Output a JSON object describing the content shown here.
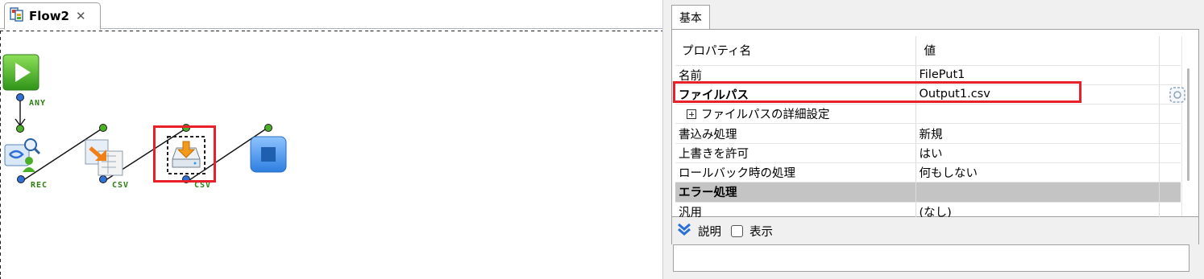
{
  "editor": {
    "tab_label": "Flow2",
    "tab_close": "✕",
    "ports": {
      "any": "ANY",
      "rec": "REC",
      "csv1": "CSV",
      "csv2": "CSV"
    }
  },
  "properties": {
    "tab_label": "基本",
    "columns": {
      "name": "プロパティ名",
      "value": "値"
    },
    "rows": [
      {
        "name": "名前",
        "value": "FilePut1"
      },
      {
        "name": "ファイルパス",
        "value": "Output1.csv"
      },
      {
        "name": "ファイルパスの詳細設定",
        "value": ""
      },
      {
        "name": "書込み処理",
        "value": "新規"
      },
      {
        "name": "上書きを許可",
        "value": "はい"
      },
      {
        "name": "ロールバック時の処理",
        "value": "何もしない"
      },
      {
        "name": "エラー処理",
        "value": ""
      },
      {
        "name": "汎用",
        "value": "(なし)"
      }
    ],
    "description": {
      "label": "説明",
      "toggle_label": "表示",
      "toggle_checked": false
    }
  },
  "colors": {
    "highlight": "#e8202a",
    "port_label": "#2e7d14",
    "start_node": "#4caf28",
    "end_node": "#3a8be0"
  }
}
